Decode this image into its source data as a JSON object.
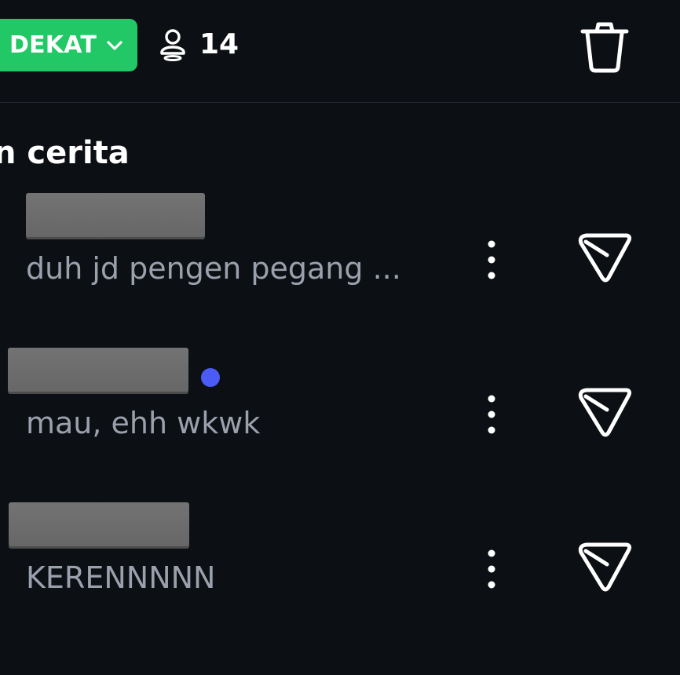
{
  "header": {
    "filter_label": "DEKAT",
    "viewer_count": "14",
    "filter_color": "#22c865"
  },
  "section": {
    "title": "n cerita"
  },
  "rows": [
    {
      "preview": "duh jd pengen pegang ...",
      "unread": false
    },
    {
      "preview": "mau, ehh wkwk",
      "unread": true
    },
    {
      "preview": "KERENNNNN",
      "unread": false
    }
  ],
  "colors": {
    "background": "#0c0f14",
    "unread_dot": "#4a5cf5",
    "preview_text": "#9aa1ad"
  },
  "icons": {
    "filter_chevron": "chevron-down-icon",
    "viewers": "viewers-icon",
    "trash": "trash-icon",
    "more": "more-vertical-icon",
    "send": "send-icon"
  }
}
